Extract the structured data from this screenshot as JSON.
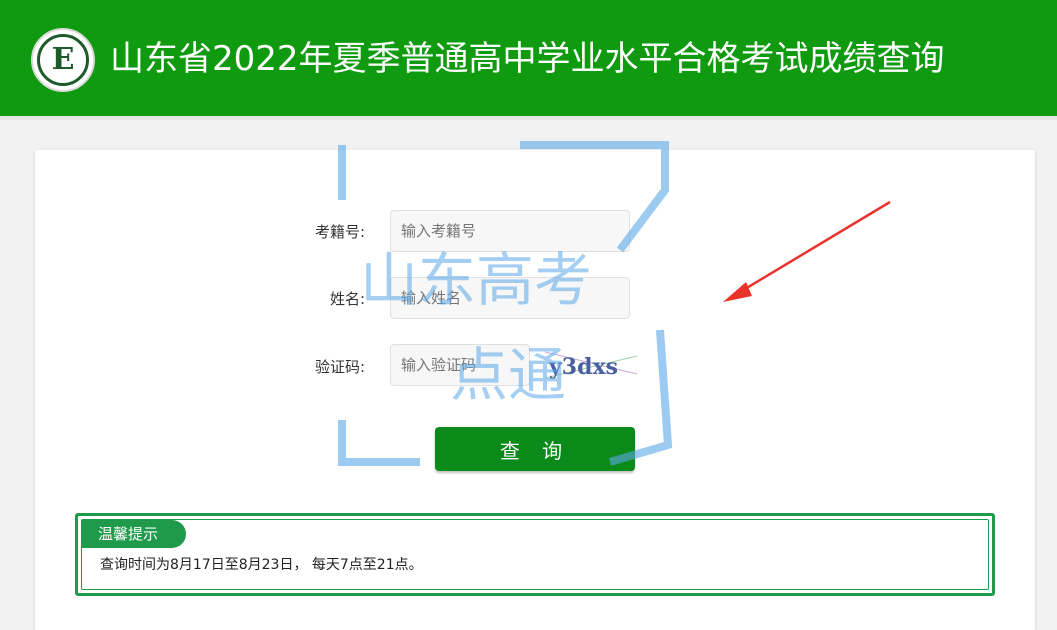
{
  "header": {
    "title": "山东省2022年夏季普通高中学业水平合格考试成绩查询",
    "logo_letter": "E",
    "background": "#0f9a0f"
  },
  "form": {
    "exam_id_label": "考籍号:",
    "exam_id_placeholder": "输入考籍号",
    "name_label": "姓名:",
    "name_placeholder": "输入姓名",
    "captcha_label": "验证码:",
    "captcha_placeholder": "输入验证码",
    "captcha_text": "y3dxs",
    "submit_label": "查 询"
  },
  "notice": {
    "tag": "温馨提示",
    "text": "查询时间为8月17日至8月23日， 每天7点至21点。",
    "accent": "#1f9a4a"
  },
  "watermark": {
    "line1": "山东高考",
    "line2": "点通"
  },
  "annotation": {
    "arrow_color": "#e8332a"
  }
}
